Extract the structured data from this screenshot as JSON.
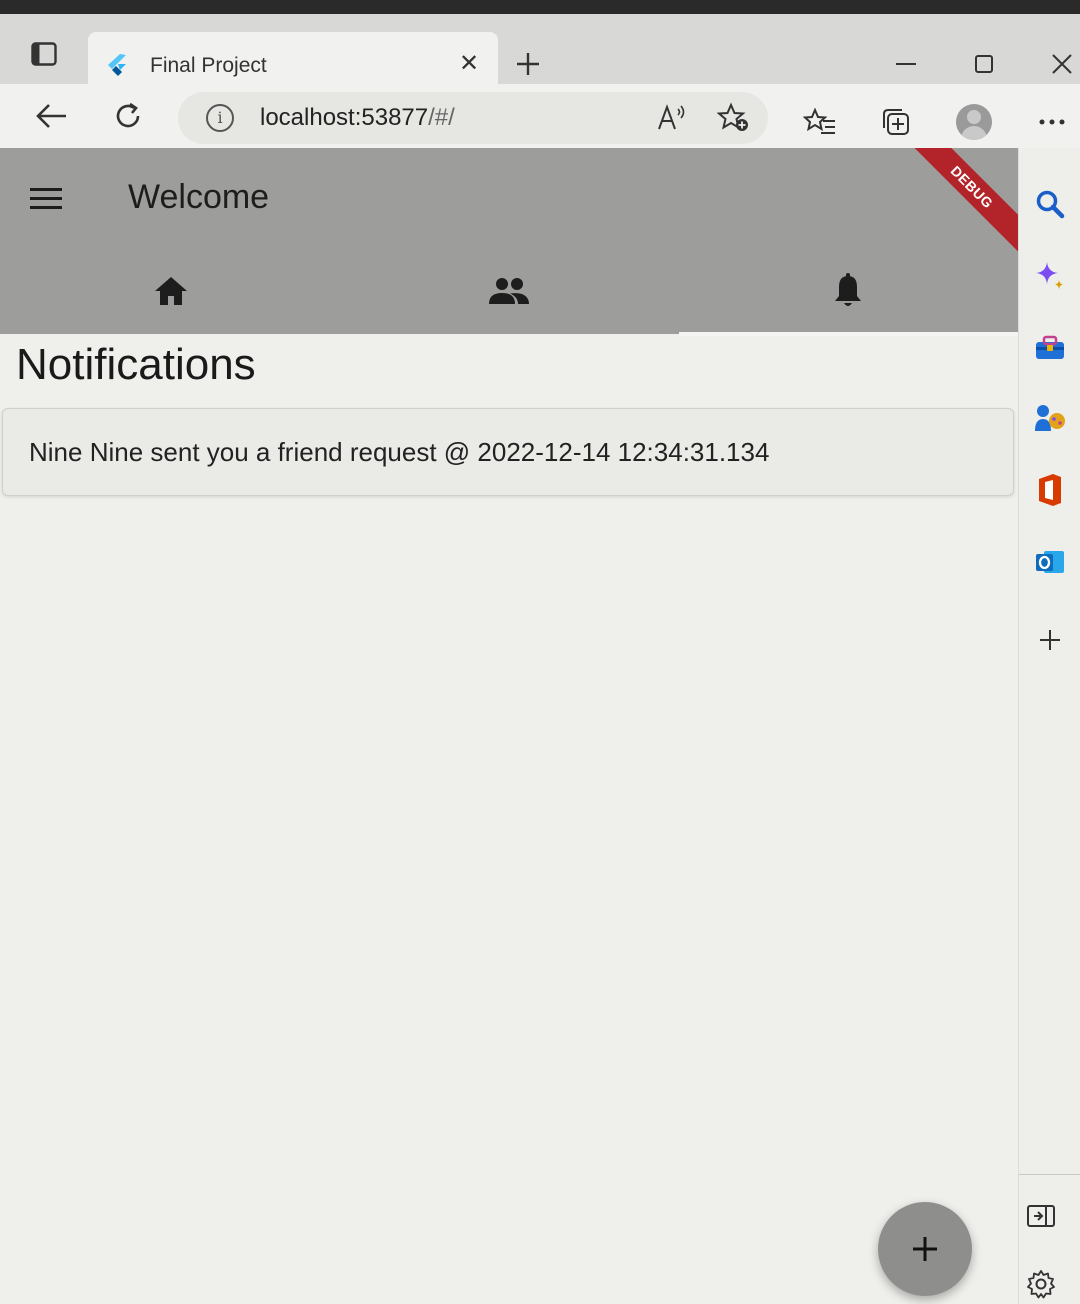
{
  "browser": {
    "tab": {
      "title": "Final Project",
      "close_glyph": "✕"
    },
    "address_bar": {
      "host": "localhost:53877",
      "path": "/#/"
    },
    "icons": {
      "tab_actions": "tab-actions-icon",
      "favicon": "flutter-logo-icon",
      "new_tab": "plus-icon",
      "minimize": "minimize-icon",
      "maximize": "maximize-icon",
      "close_window": "close-icon",
      "back": "back-arrow-icon",
      "refresh": "refresh-icon",
      "site_info": "info-icon",
      "read_aloud": "read-aloud-icon",
      "add_favorite": "add-favorite-icon",
      "favorites": "favorites-icon",
      "collections": "collections-icon",
      "profile": "profile-avatar-icon",
      "more": "more-icon"
    },
    "sidebar_icons": [
      "search-icon",
      "copilot-icon",
      "tools-icon",
      "games-icon",
      "office-icon",
      "outlook-icon",
      "add-icon",
      "hide-sidebar-icon",
      "settings-icon"
    ]
  },
  "app": {
    "appbar_title": "Welcome",
    "debug_banner": "DEBUG",
    "tabs": [
      {
        "icon": "home-icon",
        "selected": false
      },
      {
        "icon": "people-icon",
        "selected": false
      },
      {
        "icon": "bell-icon",
        "selected": true
      }
    ],
    "section_title": "Notifications",
    "notifications": [
      {
        "text": "Nine Nine sent you a friend request @ 2022-12-14 12:34:31.134"
      }
    ],
    "fab": {
      "icon": "plus-icon",
      "glyph": "+"
    }
  },
  "colors": {
    "appbar": "#9d9d9b",
    "debug_banner": "#b3242a",
    "fab": "#8e8e8c",
    "copilot": "#7a4ef0",
    "outlook": "#0f6cbd",
    "office": "#d83b01"
  }
}
